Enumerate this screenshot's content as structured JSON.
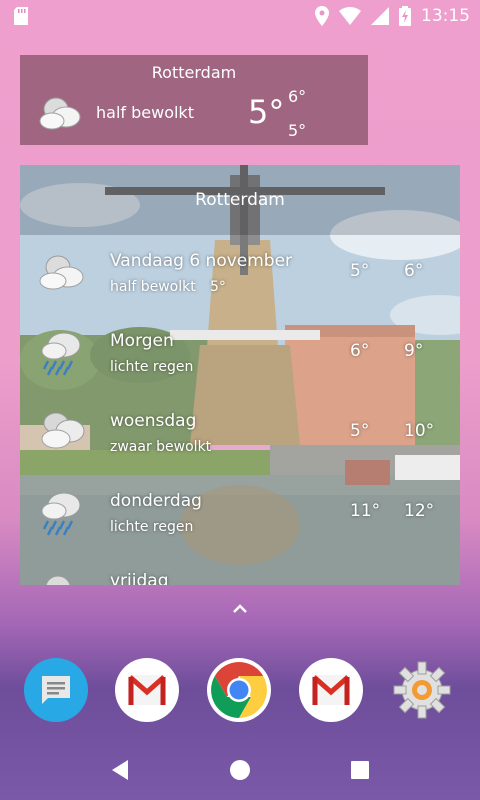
{
  "status_bar": {
    "time": "13:15",
    "icons": [
      "sd-card-icon",
      "location-icon",
      "wifi-icon",
      "signal-icon",
      "battery-charging-icon"
    ]
  },
  "small_widget": {
    "city": "Rotterdam",
    "condition": "half bewolkt",
    "temperature": "5°",
    "high": "6°",
    "low": "5°",
    "icon": "partly-cloudy-icon"
  },
  "big_widget": {
    "city": "Rotterdam",
    "days": [
      {
        "name": "Vandaag 6 november",
        "condition": "half bewolkt",
        "extra": "5°",
        "low": "5°",
        "high": "6°",
        "icon": "partly-cloudy-icon"
      },
      {
        "name": "Morgen",
        "condition": "lichte regen",
        "extra": "",
        "low": "6°",
        "high": "9°",
        "icon": "light-rain-icon"
      },
      {
        "name": "woensdag",
        "condition": "zwaar bewolkt",
        "extra": "",
        "low": "5°",
        "high": "10°",
        "icon": "overcast-icon"
      },
      {
        "name": "donderdag",
        "condition": "lichte regen",
        "extra": "",
        "low": "11°",
        "high": "12°",
        "icon": "light-rain-icon"
      },
      {
        "name": "vrijdag",
        "condition": "",
        "extra": "",
        "low": "",
        "high": "",
        "icon": "partly-cloudy-icon"
      }
    ]
  },
  "dock": {
    "apps": [
      "messages-icon",
      "gmail-icon",
      "chrome-icon",
      "gmail-icon",
      "settings-icon"
    ]
  },
  "nav": {
    "buttons": [
      "back-icon",
      "home-icon",
      "recents-icon"
    ]
  },
  "colors": {
    "wallpaper_top": "#ee9fcd",
    "wallpaper_bottom": "#6e4e9b",
    "widget_bg": "#825064"
  }
}
